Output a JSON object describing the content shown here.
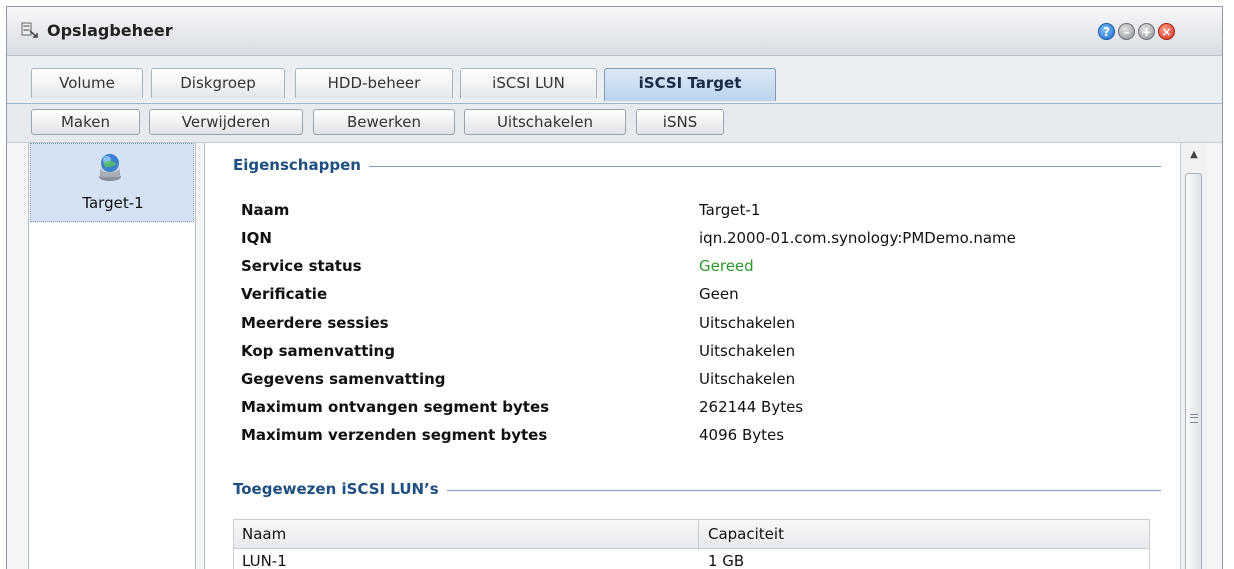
{
  "window": {
    "title": "Opslagbeheer"
  },
  "title_controls": [
    "help-icon",
    "minimize-icon",
    "maximize-icon",
    "close-icon"
  ],
  "tabs": [
    {
      "label": "Volume",
      "active": false
    },
    {
      "label": "Diskgroep",
      "active": false
    },
    {
      "label": "HDD-beheer",
      "active": false
    },
    {
      "label": "iSCSI LUN",
      "active": false
    },
    {
      "label": "iSCSI Target",
      "active": true
    }
  ],
  "toolbar": {
    "create": "Maken",
    "delete": "Verwijderen",
    "edit": "Bewerken",
    "disable": "Uitschakelen",
    "isns": "iSNS"
  },
  "sidebar": {
    "items": [
      {
        "label": "Target-1",
        "icon": "globe-target-icon",
        "selected": true
      }
    ]
  },
  "properties": {
    "section_title": "Eigenschappen",
    "rows": [
      {
        "label": "Naam",
        "value": "Target-1"
      },
      {
        "label": "IQN",
        "value": "iqn.2000-01.com.synology:PMDemo.name"
      },
      {
        "label": "Service status",
        "value": "Gereed"
      },
      {
        "label": "Verificatie",
        "value": "Geen"
      },
      {
        "label": "Meerdere sessies",
        "value": "Uitschakelen"
      },
      {
        "label": "Kop samenvatting",
        "value": "Uitschakelen"
      },
      {
        "label": "Gegevens samenvatting",
        "value": "Uitschakelen"
      },
      {
        "label": "Maximum ontvangen segment bytes",
        "value": "262144 Bytes"
      },
      {
        "label": "Maximum verzenden segment bytes",
        "value": "4096 Bytes"
      }
    ]
  },
  "luns": {
    "section_title": "Toegewezen iSCSI LUN’s",
    "columns": [
      "Naam",
      "Capaciteit"
    ],
    "rows": [
      {
        "name": "LUN-1",
        "capacity": "1 GB"
      }
    ]
  },
  "colors": {
    "status_ok": "#2a9a2a",
    "section_title": "#1d4f80",
    "accent": "#bcd3ec"
  }
}
